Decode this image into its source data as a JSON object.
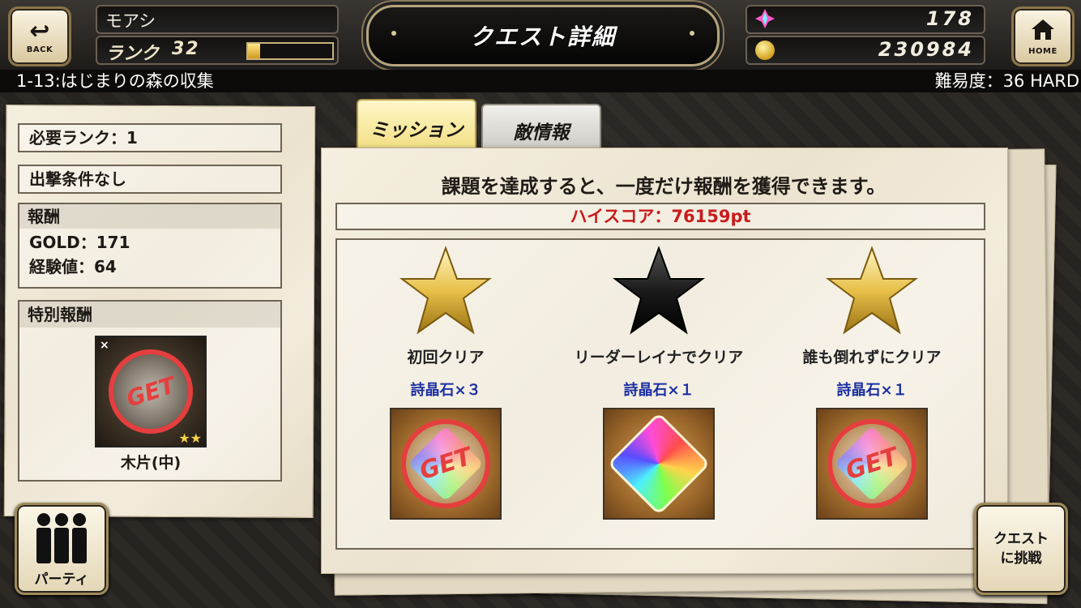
{
  "header": {
    "back_label": "BACK",
    "home_label": "HOME",
    "player_name": "モアシ",
    "rank_label": "ランク",
    "rank_value": "32",
    "rank_progress": 0.14,
    "title": "クエスト詳細",
    "crystal_count": "178",
    "gold_count": "230984"
  },
  "quest": {
    "name": "1-13:はじまりの森の収集",
    "difficulty": "難易度：36 HARD"
  },
  "left_panel": {
    "required_rank": "必要ランク：1",
    "sortie_condition": "出撃条件なし",
    "reward_header": "報酬",
    "reward_gold": "GOLD：171",
    "reward_exp": "経験値：64",
    "special_reward_header": "特別報酬",
    "special_item_name": "木片(中)",
    "special_item_stamp": "GET",
    "special_item_stars": "★★",
    "special_item_qty": "×"
  },
  "tabs": [
    {
      "label": "ミッション",
      "active": true
    },
    {
      "label": "敵情報",
      "active": false
    }
  ],
  "mission_panel": {
    "description": "課題を達成すると、一度だけ報酬を獲得できます。",
    "highscore": "ハイスコア：76159pt",
    "missions": [
      {
        "name": "初回クリア",
        "reward": "詩晶石×３",
        "achieved": true,
        "stamp": "GET"
      },
      {
        "name": "リーダーレイナでクリア",
        "reward": "詩晶石×１",
        "achieved": false,
        "stamp": ""
      },
      {
        "name": "誰も倒れずにクリア",
        "reward": "詩晶石×１",
        "achieved": true,
        "stamp": "GET"
      }
    ]
  },
  "buttons": {
    "party": "パーティ",
    "challenge": "クエストに挑戦"
  },
  "colors": {
    "star_gold": "#e8c04a",
    "star_black": "#1b1b1b",
    "stamp_red": "#e53e3e",
    "reward_blue": "#1b2fa4",
    "highscore_red": "#c81c1c"
  },
  "icons": {
    "back": "back-arrow-icon",
    "home": "home-icon",
    "crystal": "crystal-icon",
    "gold": "gold-coin-icon",
    "party": "party-members-icon"
  }
}
